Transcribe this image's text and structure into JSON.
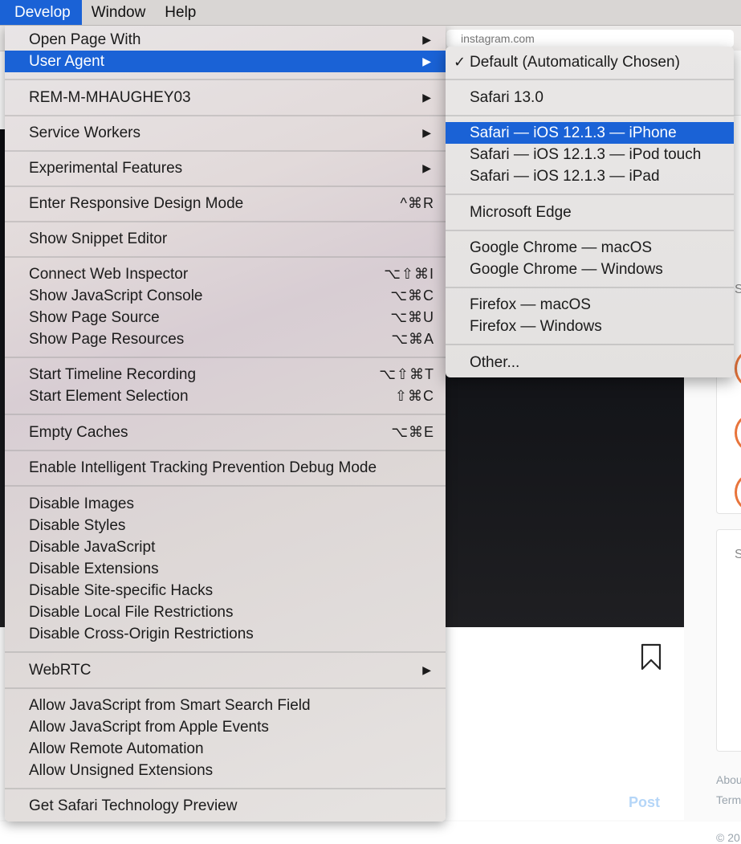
{
  "menubar": {
    "items": [
      {
        "label": "Develop",
        "active": true
      },
      {
        "label": "Window",
        "active": false
      },
      {
        "label": "Help",
        "active": false
      }
    ]
  },
  "browser": {
    "address_text": "instagram.com",
    "post_button": "Post",
    "footer": [
      "Abou",
      "Term",
      "© 20"
    ],
    "sidebar_letters": [
      "S",
      "S"
    ]
  },
  "develop_menu": {
    "items": [
      {
        "label": "Open Page With",
        "shortcut": "",
        "submenu": true,
        "highlighted": false
      },
      {
        "label": "User Agent",
        "shortcut": "",
        "submenu": true,
        "highlighted": true
      },
      {
        "label": "REM-M-MHAUGHEY03",
        "shortcut": "",
        "submenu": true,
        "highlighted": false
      },
      {
        "label": "Service Workers",
        "shortcut": "",
        "submenu": true,
        "highlighted": false
      },
      {
        "label": "Experimental Features",
        "shortcut": "",
        "submenu": true,
        "highlighted": false
      },
      {
        "label": "Enter Responsive Design Mode",
        "shortcut": "^⌘R",
        "submenu": false,
        "highlighted": false
      },
      {
        "label": "Show Snippet Editor",
        "shortcut": "",
        "submenu": false,
        "highlighted": false
      },
      {
        "label": "Connect Web Inspector",
        "shortcut": "⌥⇧⌘I",
        "submenu": false,
        "highlighted": false
      },
      {
        "label": "Show JavaScript Console",
        "shortcut": "⌥⌘C",
        "submenu": false,
        "highlighted": false
      },
      {
        "label": "Show Page Source",
        "shortcut": "⌥⌘U",
        "submenu": false,
        "highlighted": false
      },
      {
        "label": "Show Page Resources",
        "shortcut": "⌥⌘A",
        "submenu": false,
        "highlighted": false
      },
      {
        "label": "Start Timeline Recording",
        "shortcut": "⌥⇧⌘T",
        "submenu": false,
        "highlighted": false
      },
      {
        "label": "Start Element Selection",
        "shortcut": "⇧⌘C",
        "submenu": false,
        "highlighted": false
      },
      {
        "label": "Empty Caches",
        "shortcut": "⌥⌘E",
        "submenu": false,
        "highlighted": false
      },
      {
        "label": "Enable Intelligent Tracking Prevention Debug Mode",
        "shortcut": "",
        "submenu": false,
        "highlighted": false
      },
      {
        "label": "Disable Images",
        "shortcut": "",
        "submenu": false,
        "highlighted": false
      },
      {
        "label": "Disable Styles",
        "shortcut": "",
        "submenu": false,
        "highlighted": false
      },
      {
        "label": "Disable JavaScript",
        "shortcut": "",
        "submenu": false,
        "highlighted": false
      },
      {
        "label": "Disable Extensions",
        "shortcut": "",
        "submenu": false,
        "highlighted": false
      },
      {
        "label": "Disable Site-specific Hacks",
        "shortcut": "",
        "submenu": false,
        "highlighted": false
      },
      {
        "label": "Disable Local File Restrictions",
        "shortcut": "",
        "submenu": false,
        "highlighted": false
      },
      {
        "label": "Disable Cross-Origin Restrictions",
        "shortcut": "",
        "submenu": false,
        "highlighted": false
      },
      {
        "label": "WebRTC",
        "shortcut": "",
        "submenu": true,
        "highlighted": false
      },
      {
        "label": "Allow JavaScript from Smart Search Field",
        "shortcut": "",
        "submenu": false,
        "highlighted": false
      },
      {
        "label": "Allow JavaScript from Apple Events",
        "shortcut": "",
        "submenu": false,
        "highlighted": false
      },
      {
        "label": "Allow Remote Automation",
        "shortcut": "",
        "submenu": false,
        "highlighted": false
      },
      {
        "label": "Allow Unsigned Extensions",
        "shortcut": "",
        "submenu": false,
        "highlighted": false
      },
      {
        "label": "Get Safari Technology Preview",
        "shortcut": "",
        "submenu": false,
        "highlighted": false
      }
    ]
  },
  "user_agent_menu": {
    "items": [
      {
        "label": "Default (Automatically Chosen)",
        "checked": true,
        "highlighted": false
      },
      {
        "label": "Safari 13.0",
        "checked": false,
        "highlighted": false
      },
      {
        "label": "Safari — iOS 12.1.3 — iPhone",
        "checked": false,
        "highlighted": true
      },
      {
        "label": "Safari — iOS 12.1.3 — iPod touch",
        "checked": false,
        "highlighted": false
      },
      {
        "label": "Safari — iOS 12.1.3 — iPad",
        "checked": false,
        "highlighted": false
      },
      {
        "label": "Microsoft Edge",
        "checked": false,
        "highlighted": false
      },
      {
        "label": "Google Chrome — macOS",
        "checked": false,
        "highlighted": false
      },
      {
        "label": "Google Chrome — Windows",
        "checked": false,
        "highlighted": false
      },
      {
        "label": "Firefox — macOS",
        "checked": false,
        "highlighted": false
      },
      {
        "label": "Firefox — Windows",
        "checked": false,
        "highlighted": false
      },
      {
        "label": "Other...",
        "checked": false,
        "highlighted": false
      }
    ]
  },
  "icons": {
    "submenu_arrow": "▶",
    "checkmark": "✓",
    "bookmark": "bookmark-icon"
  },
  "colors": {
    "highlight": "#1a62d6",
    "menubar": "#d9d6d4"
  }
}
